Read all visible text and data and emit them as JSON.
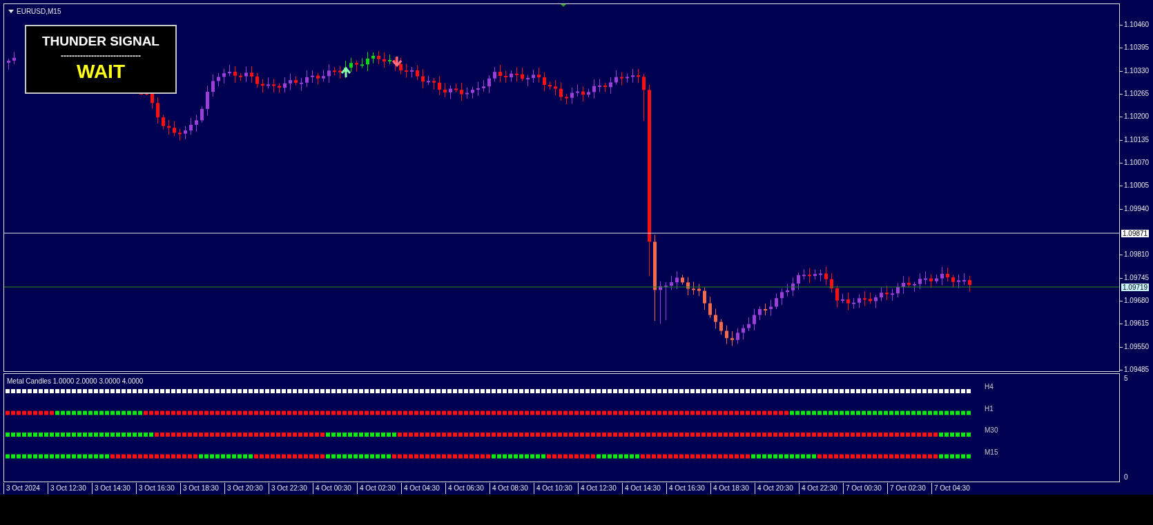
{
  "chart": {
    "title": "EURUSD,M15",
    "signal_box": {
      "title": "THUNDER SIGNAL",
      "divider": "-----------------------------",
      "status": "WAIT"
    },
    "price_axis": {
      "ticks": [
        "1.10460",
        "1.10395",
        "1.10330",
        "1.10265",
        "1.10200",
        "1.10135",
        "1.10070",
        "1.10005",
        "1.09940",
        "1.09810",
        "1.09745",
        "1.09680",
        "1.09615",
        "1.09550",
        "1.09485"
      ],
      "markers": [
        {
          "label": "1.09871",
          "kind": "line"
        },
        {
          "label": "1.09719",
          "kind": "bid"
        }
      ]
    }
  },
  "indicator": {
    "title": "Metal Candles 1.0000 2.0000 3.0000 4.0000",
    "rows": [
      {
        "label": "H4"
      },
      {
        "label": "H1"
      },
      {
        "label": "M30"
      },
      {
        "label": "M15"
      }
    ],
    "scale": [
      "5",
      "0"
    ]
  },
  "time_axis": [
    "3 Oct 2024",
    "3 Oct 12:30",
    "3 Oct 14:30",
    "3 Oct 16:30",
    "3 Oct 18:30",
    "3 Oct 20:30",
    "3 Oct 22:30",
    "4 Oct 00:30",
    "4 Oct 02:30",
    "4 Oct 04:30",
    "4 Oct 06:30",
    "4 Oct 08:30",
    "4 Oct 10:30",
    "4 Oct 12:30",
    "4 Oct 14:30",
    "4 Oct 16:30",
    "4 Oct 18:30",
    "4 Oct 20:30",
    "4 Oct 22:30",
    "7 Oct 00:30",
    "7 Oct 02:30",
    "7 Oct 04:30"
  ]
}
